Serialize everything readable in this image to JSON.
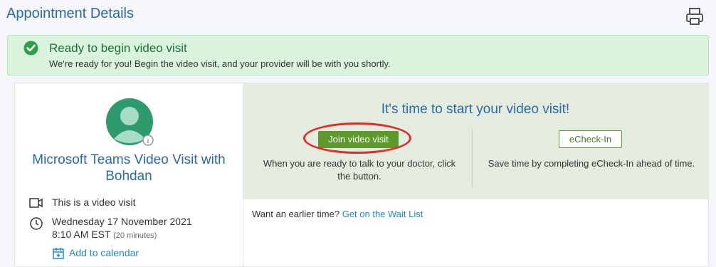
{
  "header": {
    "title": "Appointment Details"
  },
  "icons": {
    "print": "print-icon",
    "check": "check-circle-icon",
    "video": "video-camera-icon",
    "clock": "clock-icon",
    "calendar": "calendar-icon",
    "avatar": "avatar-icon"
  },
  "banner": {
    "title": "Ready to begin video visit",
    "subtitle": "We're ready for you! Begin the video visit, and your provider will be with you shortly."
  },
  "visit": {
    "title": "Microsoft Teams Video Visit with Bohdan",
    "type_label": "This is a video visit",
    "date": "Wednesday 17 November 2021",
    "time": "8:10 AM EST",
    "duration": "(20 minutes)",
    "add_calendar": "Add to calendar"
  },
  "start": {
    "heading": "It's time to start your video visit!",
    "join_label": "Join video visit",
    "join_desc": "When you are ready to talk to your doctor, click the button.",
    "echeck_label": "eCheck-In",
    "echeck_desc": "Save time by completing eCheck-In ahead of time."
  },
  "waitlist": {
    "prompt": "Want an earlier time?",
    "link": "Get on the Wait List"
  },
  "colors": {
    "accent": "#2a6aa5",
    "success": "#5c9a2c",
    "banner_bg": "#d9f3dd",
    "highlight": "#e32b2b",
    "link": "#1b8ad3"
  }
}
